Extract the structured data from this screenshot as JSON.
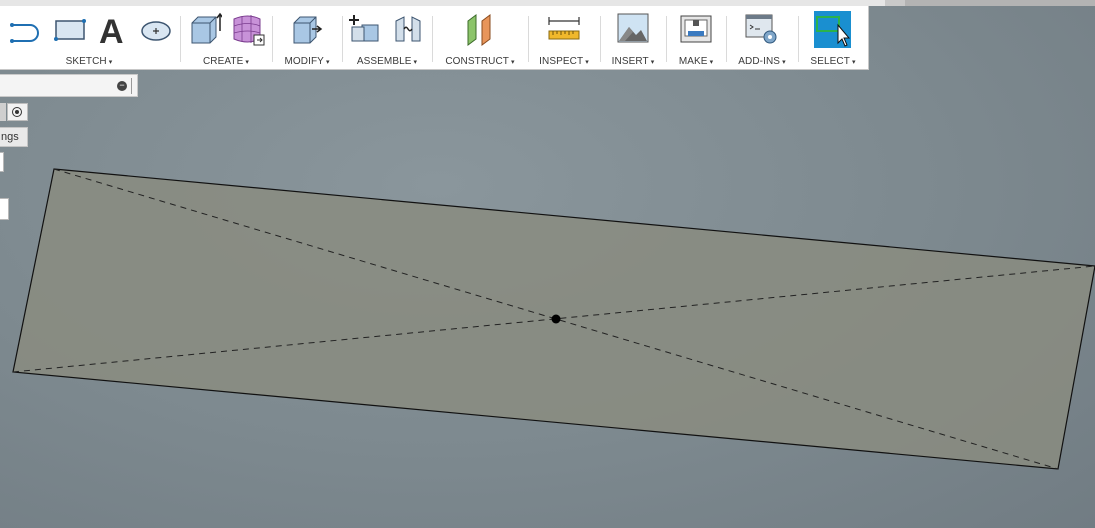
{
  "toolbar": {
    "groups": [
      {
        "label": "SKETCH",
        "icons": [
          "sketch-line-arc-icon",
          "rectangle-icon",
          "text-icon",
          "ellipse-point-icon"
        ]
      },
      {
        "label": "CREATE",
        "icons": [
          "extrude-box-icon",
          "form-grid-icon"
        ]
      },
      {
        "label": "MODIFY",
        "icons": [
          "press-pull-icon"
        ]
      },
      {
        "label": "ASSEMBLE",
        "icons": [
          "new-component-icon",
          "joint-icon"
        ]
      },
      {
        "label": "CONSTRUCT",
        "icons": [
          "offset-plane-icon"
        ]
      },
      {
        "label": "INSPECT",
        "icons": [
          "measure-icon"
        ]
      },
      {
        "label": "INSERT",
        "icons": [
          "insert-image-icon"
        ]
      },
      {
        "label": "MAKE",
        "icons": [
          "3d-print-icon"
        ]
      },
      {
        "label": "ADD-INS",
        "icons": [
          "scripts-addins-icon"
        ]
      },
      {
        "label": "SELECT",
        "icons": [
          "window-select-icon"
        ]
      }
    ],
    "caret": "▾",
    "accent": "#1a8fd0"
  },
  "browser": {
    "collapse_symbol": "−",
    "tab_label": "ngs"
  },
  "viewport": {
    "background": "#7d898f",
    "profile_fill": "#8a8c80",
    "edge_color": "#111111"
  }
}
